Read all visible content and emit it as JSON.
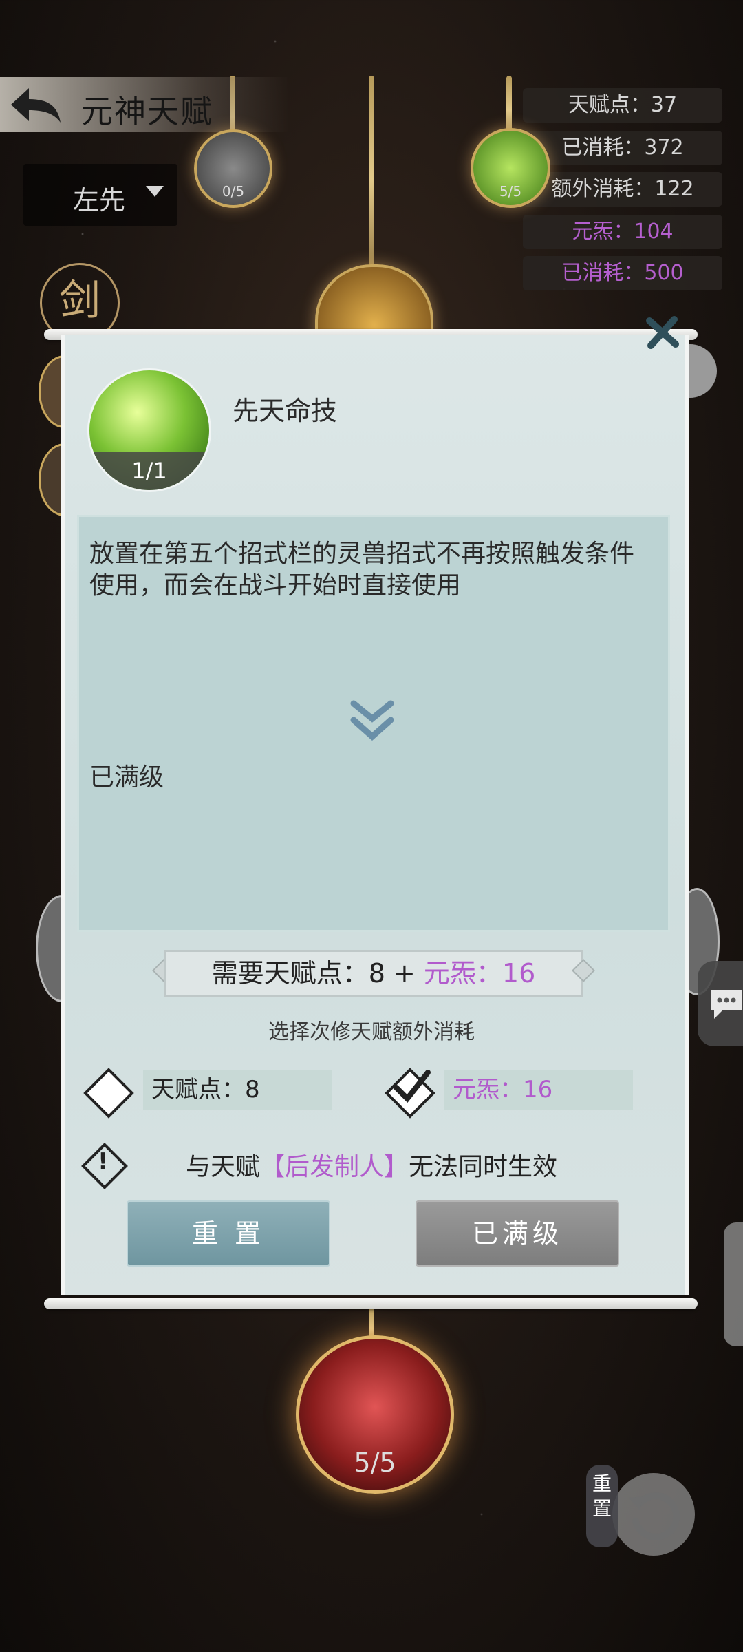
{
  "header": {
    "title": "元神天赋"
  },
  "dropdown": {
    "selected": "左先"
  },
  "stats": [
    {
      "label": "天赋点：37"
    },
    {
      "label": "已消耗：372"
    },
    {
      "label": "额外消耗：122"
    },
    {
      "label": "元炁：104"
    },
    {
      "label": "已消耗：500"
    }
  ],
  "nodes": {
    "top_left_count": "0/5",
    "top_right_count": "5/5",
    "bottom_count": "5/5"
  },
  "side_marks": {
    "sword": "剑"
  },
  "skill": {
    "name": "先天命技",
    "level": "1/1",
    "description": "放置在第五个招式栏的灵兽招式不再按照触发条件使用，而会在战斗开始时直接使用",
    "max_text": "已满级"
  },
  "requirement": {
    "prefix": "需要天赋点：8 + ",
    "purple": "元炁：16"
  },
  "choose_text": "选择次修天赋额外消耗",
  "options": [
    {
      "label": "天赋点：8",
      "checked": false
    },
    {
      "label": "元炁：16",
      "checked": true
    }
  ],
  "warning": {
    "prefix": "与天赋",
    "talent": "【后发制人】",
    "suffix": "无法同时生效"
  },
  "buttons": {
    "reset": "重 置",
    "max": "已满级"
  },
  "reset_tag": "重置",
  "colors": {
    "purple": "#b15bcc",
    "gold": "#c9a75d"
  }
}
